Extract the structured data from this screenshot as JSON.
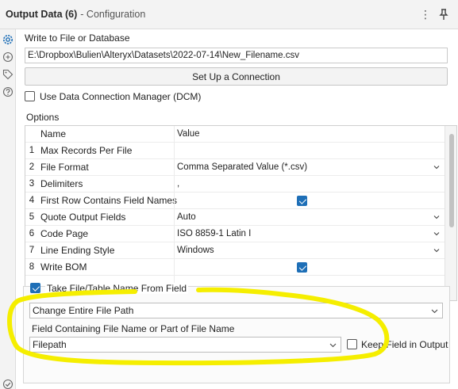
{
  "header": {
    "title": "Output Data (6)",
    "subtitle": "- Configuration"
  },
  "write_section": {
    "label": "Write to File or Database",
    "path_value": "E:\\Dropbox\\Bulien\\Alteryx\\Datasets\\2022-07-14\\New_Filename.csv",
    "setup_button": "Set Up a Connection",
    "dcm_label": "Use Data Connection Manager (DCM)",
    "dcm_checked": false
  },
  "options": {
    "label": "Options",
    "col_name": "Name",
    "col_value": "Value",
    "rows": [
      {
        "num": "1",
        "name": "Max Records Per File",
        "value": "",
        "kind": "text"
      },
      {
        "num": "2",
        "name": "File Format",
        "value": "Comma Separated Value (*.csv)",
        "kind": "select"
      },
      {
        "num": "3",
        "name": "Delimiters",
        "value": ",",
        "kind": "text"
      },
      {
        "num": "4",
        "name": "First Row Contains Field Names",
        "value": "",
        "kind": "check"
      },
      {
        "num": "5",
        "name": "Quote Output Fields",
        "value": "Auto",
        "kind": "select"
      },
      {
        "num": "6",
        "name": "Code Page",
        "value": "ISO 8859-1 Latin I",
        "kind": "select"
      },
      {
        "num": "7",
        "name": "Line Ending Style",
        "value": "Windows",
        "kind": "select"
      },
      {
        "num": "8",
        "name": "Write BOM",
        "value": "",
        "kind": "check"
      }
    ]
  },
  "take_from_field": {
    "label": "Take File/Table Name From Field",
    "checked": true,
    "mode_value": "Change Entire File Path",
    "field_label": "Field Containing File Name or Part of File Name",
    "field_value": "Filepath",
    "keep_label": "Keep Field in Output",
    "keep_checked": false
  },
  "icons": [
    "gear-icon",
    "target-icon",
    "tag-icon",
    "help-icon",
    "check-circle-icon",
    "kebab-menu-icon",
    "pin-icon",
    "chevron-down-icon"
  ],
  "colors": {
    "accent": "#1e6fb7",
    "highlight": "#f5ee00"
  }
}
